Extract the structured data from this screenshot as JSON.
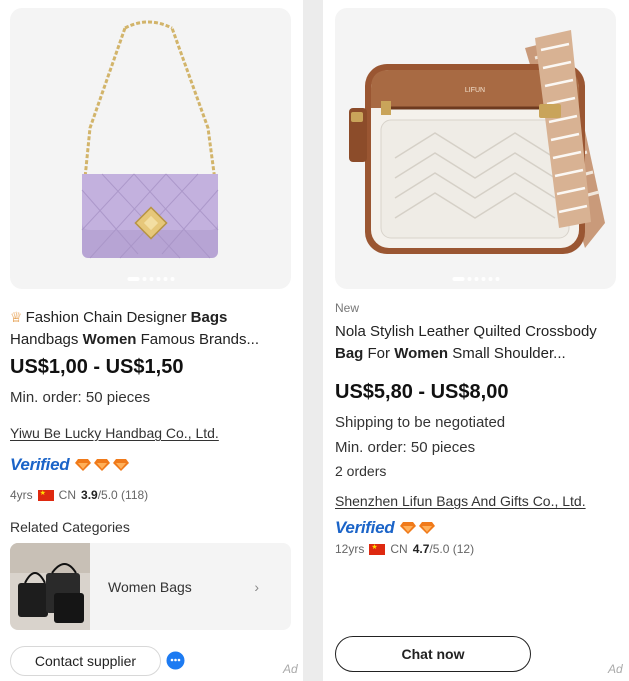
{
  "left_card": {
    "title_parts": [
      {
        "text": "Fashion Chain Designer ",
        "bold": false
      },
      {
        "text": "Bags",
        "bold": true
      },
      {
        "text": " Handbags ",
        "bold": false
      },
      {
        "text": "Women",
        "bold": true
      },
      {
        "text": " Famous Brands...",
        "bold": false
      }
    ],
    "title_icon": "crown-icon",
    "price": "US$1,00 - US$1,50",
    "min_order": "Min. order: 50 pieces",
    "supplier": "Yiwu Be Lucky Handbag Co., Ltd.",
    "verified_label": "Verified",
    "diamond_count": 3,
    "years": "4yrs",
    "country": "CN",
    "rating": "3.9",
    "rating_suffix": "/5.0 (118)",
    "related_title": "Related Categories",
    "related_item": "Women Bags",
    "contact_label": "Contact supplier",
    "ad_label": "Ad"
  },
  "right_card": {
    "badge": "New",
    "title_line1": "Nola Stylish Leather Quilted Crossbody",
    "title_parts_line2": [
      {
        "text": "Bag",
        "bold": true
      },
      {
        "text": " For ",
        "bold": false
      },
      {
        "text": "Women",
        "bold": true
      },
      {
        "text": " Small Shoulder...",
        "bold": false
      }
    ],
    "price": "US$5,80 - US$8,00",
    "shipping": "Shipping to be negotiated",
    "min_order": "Min. order: 50 pieces",
    "orders": "2 orders",
    "supplier": "Shenzhen Lifun Bags And Gifts Co., Ltd.",
    "verified_label": "Verified",
    "diamond_count": 2,
    "years": "12yrs",
    "country": "CN",
    "rating": "4.7",
    "rating_suffix": "/5.0 (12)",
    "chat_label": "Chat now",
    "ad_label": "Ad",
    "bag_brand_text": "LIFUN"
  },
  "colors": {
    "verified_blue": "#1b64c8",
    "diamond_orange": "#f07a1a",
    "crown_orange": "#e08a2b",
    "flag_red": "#de2910"
  }
}
